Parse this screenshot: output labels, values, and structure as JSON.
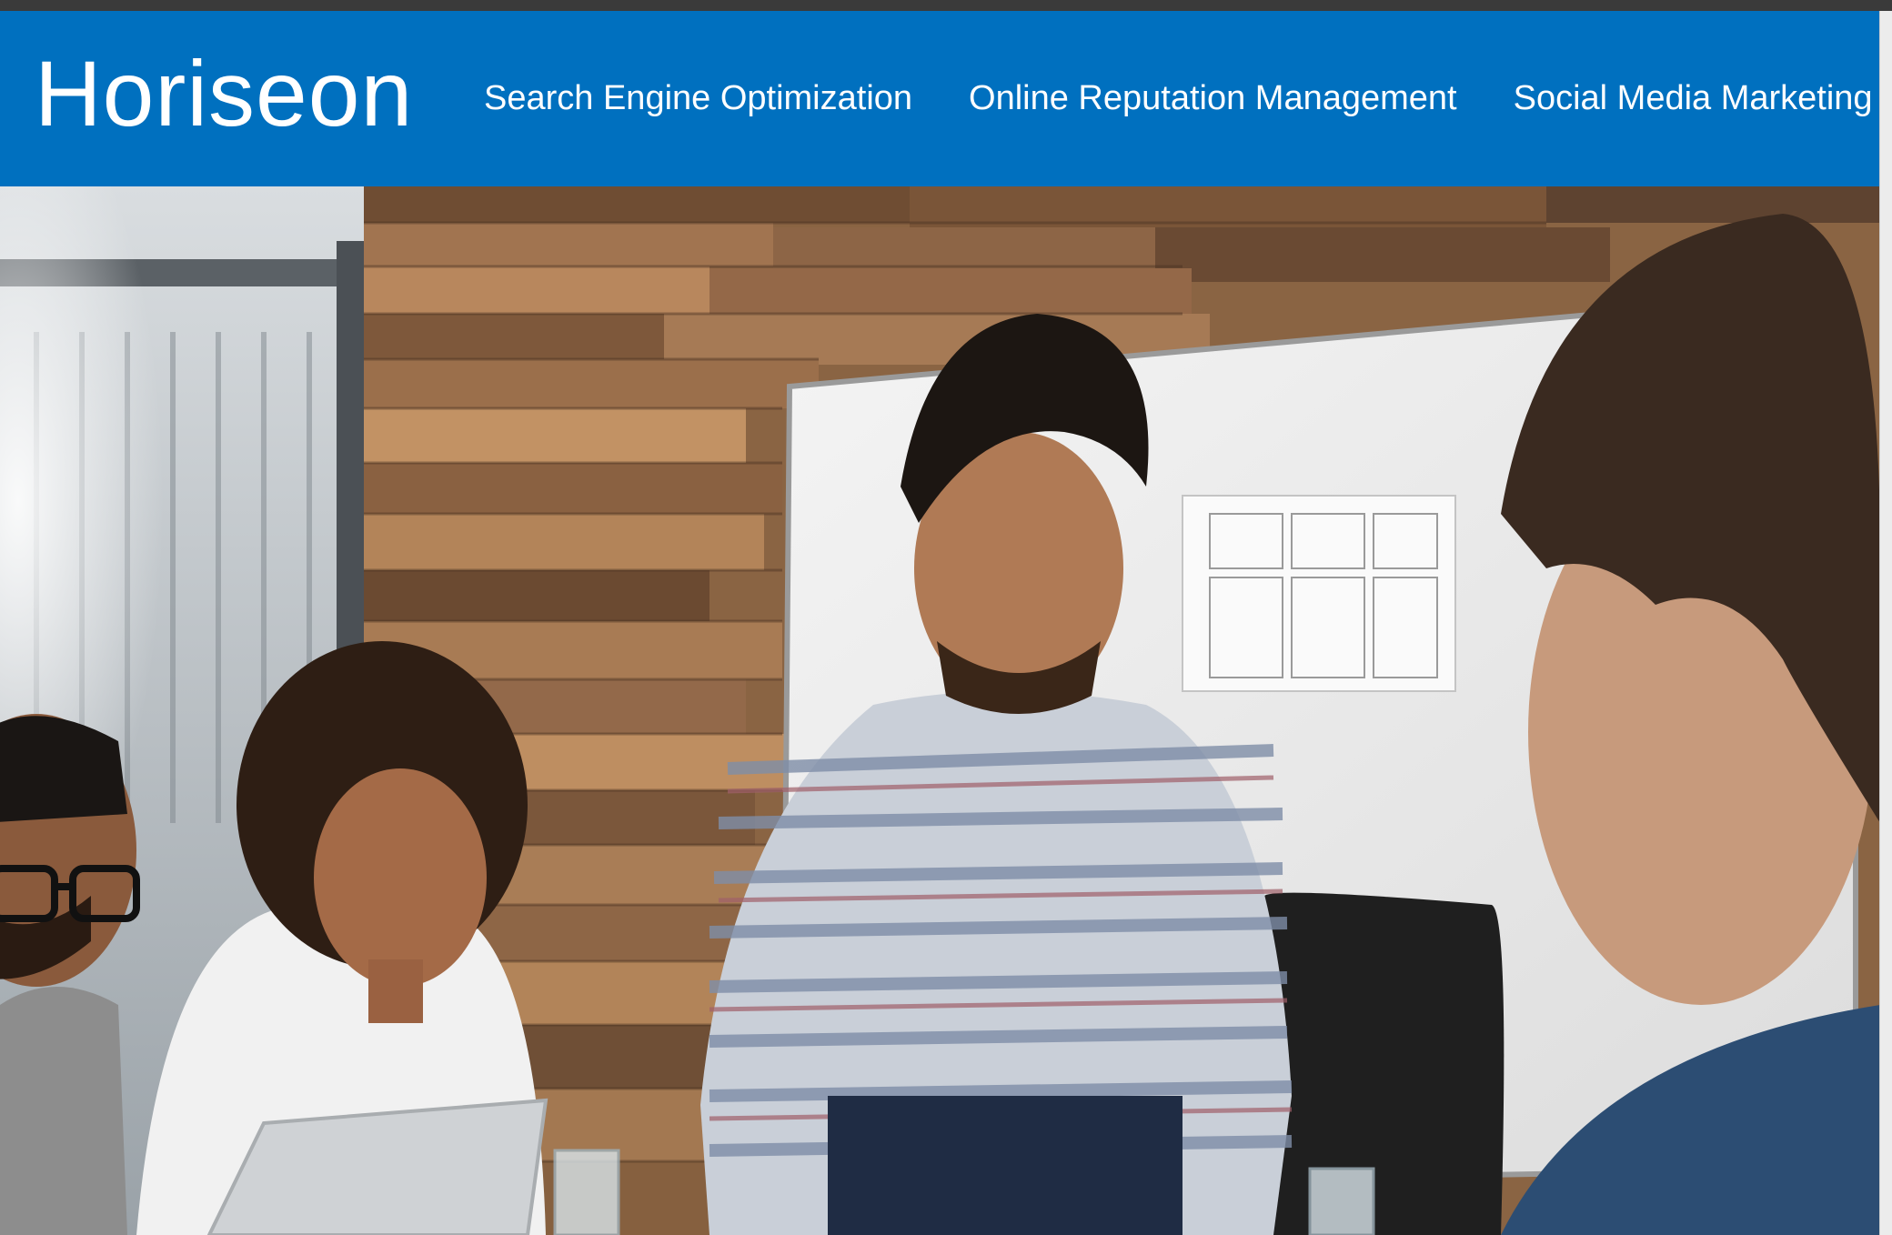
{
  "header": {
    "logo": "Horiseon",
    "nav": [
      {
        "label": "Search Engine Optimization"
      },
      {
        "label": "Online Reputation Management"
      },
      {
        "label": "Social Media Marketing"
      }
    ],
    "background_color": "#0070bf",
    "text_color": "#ffffff"
  },
  "hero": {
    "image": "photo-of-team-meeting-around-laptop"
  }
}
